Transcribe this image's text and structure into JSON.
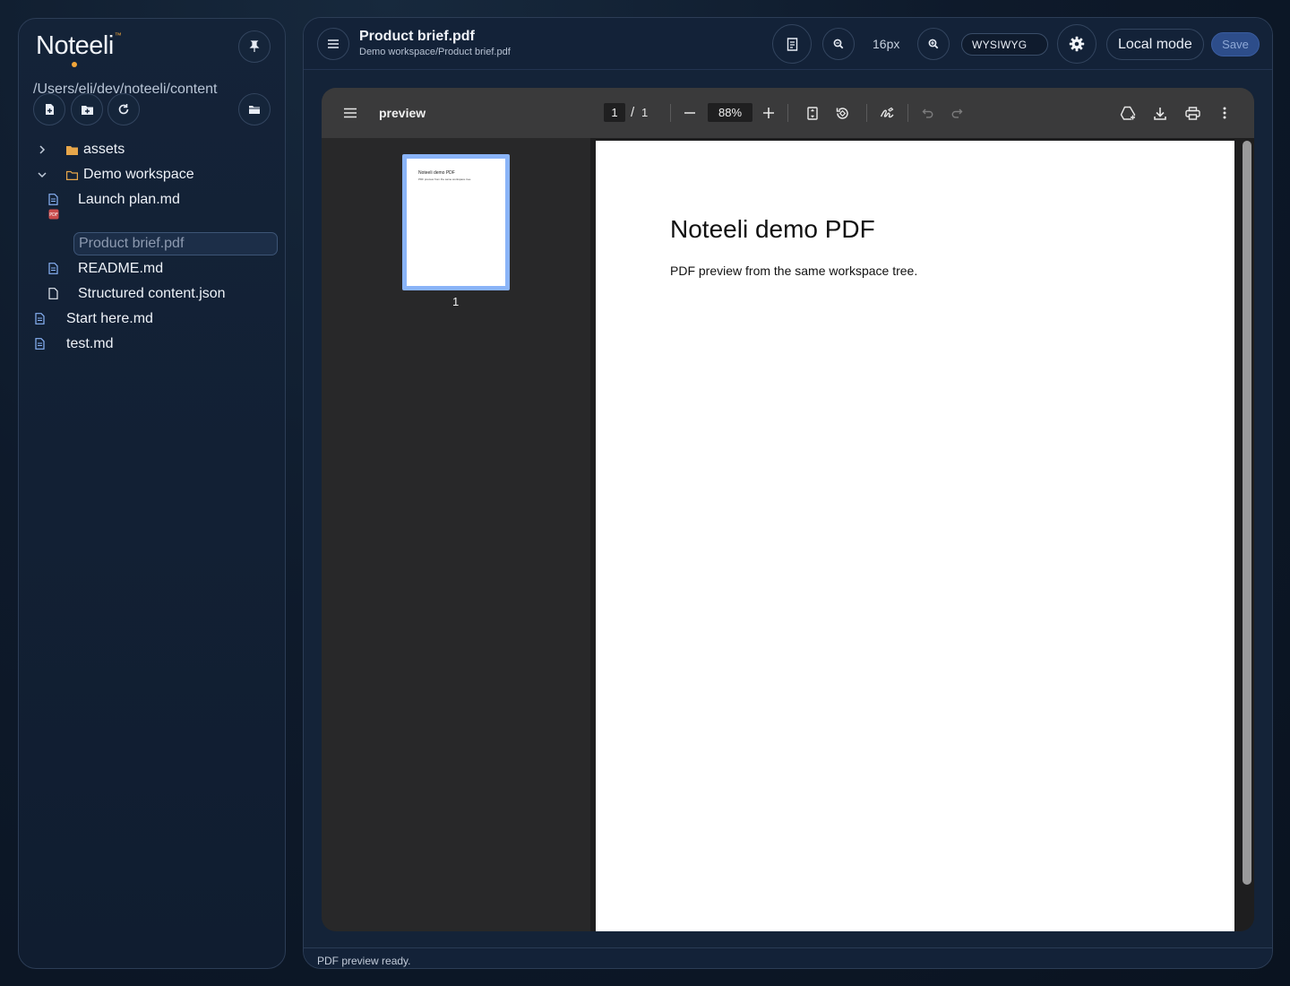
{
  "sidebar": {
    "logo_text": "Noteeli",
    "logo_mark": "™",
    "root_path": "/Users/eli/dev/noteeli/content",
    "icons": {
      "pin": "pin-icon",
      "new_file": "new-file-icon",
      "new_folder": "new-folder-icon",
      "refresh": "refresh-icon",
      "open_folder": "open-folder-icon"
    },
    "tree": [
      {
        "label": "assets",
        "type": "folder",
        "expanded": false
      },
      {
        "label": "Demo workspace",
        "type": "folder",
        "expanded": true
      },
      {
        "label": "Launch plan.md",
        "type": "markdown"
      },
      {
        "label": "Product brief.pdf",
        "type": "pdf",
        "selected": true
      },
      {
        "label": "README.md",
        "type": "markdown"
      },
      {
        "label": "Structured content.json",
        "type": "json"
      },
      {
        "label": "Start here.md",
        "type": "markdown"
      },
      {
        "label": "test.md",
        "type": "markdown"
      }
    ]
  },
  "header": {
    "title": "Product brief.pdf",
    "path": "Demo workspace/Product brief.pdf",
    "font_size": "16px",
    "mode": "WYSIWYG",
    "local_mode_label": "Local mode",
    "save_label": "Save"
  },
  "viewer": {
    "title": "preview",
    "current_page": "1",
    "page_separator": "/",
    "total_pages": "1",
    "zoom": "88%",
    "thumbnail_label": "1",
    "pdf_heading": "Noteeli demo PDF",
    "pdf_body": "PDF preview from the same workspace tree."
  },
  "status": {
    "message": "PDF preview ready."
  },
  "colors": {
    "accent": "#f2a63a",
    "save_button": "#2d4d8a",
    "thumbnail_highlight": "#8ab4f8",
    "pdf_icon": "#e35d5d"
  }
}
